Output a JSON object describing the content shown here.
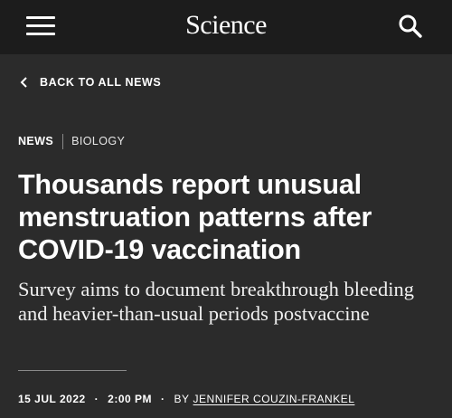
{
  "header": {
    "logo": "Science",
    "menu_icon": "hamburger-menu-icon",
    "search_icon": "search-icon"
  },
  "nav": {
    "back_label": "BACK TO ALL NEWS",
    "back_icon": "chevron-left-icon"
  },
  "article": {
    "tags": [
      "NEWS",
      "BIOLOGY"
    ],
    "headline": "Thousands report unusual menstruation patterns after COVID-19 vaccination",
    "dek": "Survey aims to document breakthrough bleeding and heavier-than-usual periods postvaccine",
    "date": "15 JUL 2022",
    "time": "2:00 PM",
    "by_label": "BY",
    "author": "JENNIFER COUZIN-FRANKEL"
  },
  "colors": {
    "background": "#2b2b2b",
    "topbar": "#1c1c1c",
    "text": "#ffffff"
  }
}
